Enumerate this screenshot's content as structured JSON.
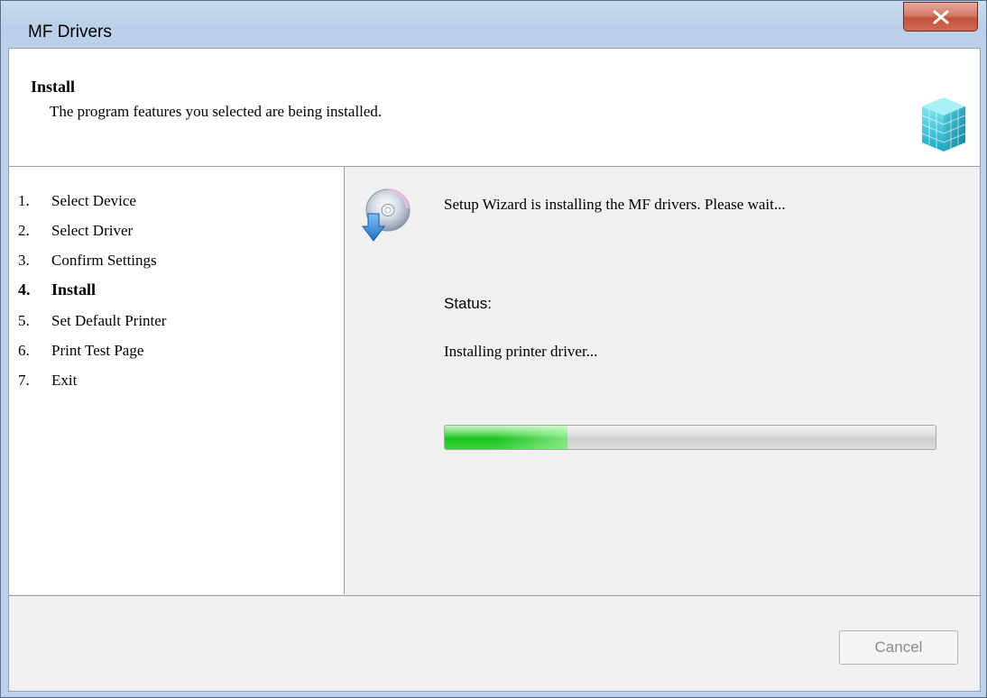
{
  "window": {
    "title": "MF Drivers"
  },
  "header": {
    "title": "Install",
    "subtitle": "The program features you selected are being installed."
  },
  "steps": [
    {
      "num": "1.",
      "label": "Select Device"
    },
    {
      "num": "2.",
      "label": "Select Driver"
    },
    {
      "num": "3.",
      "label": "Confirm Settings"
    },
    {
      "num": "4.",
      "label": "Install"
    },
    {
      "num": "5.",
      "label": "Set Default Printer"
    },
    {
      "num": "6.",
      "label": "Print Test Page"
    },
    {
      "num": "7.",
      "label": "Exit"
    }
  ],
  "active_step_index": 3,
  "main": {
    "message": "Setup Wizard is installing the MF drivers. Please wait...",
    "status_label": "Status:",
    "status_text": "Installing printer driver...",
    "progress_percent": 25
  },
  "footer": {
    "cancel_label": "Cancel"
  },
  "icons": {
    "close": "close-icon",
    "header": "package-cube-icon",
    "setup": "cd-install-icon"
  }
}
